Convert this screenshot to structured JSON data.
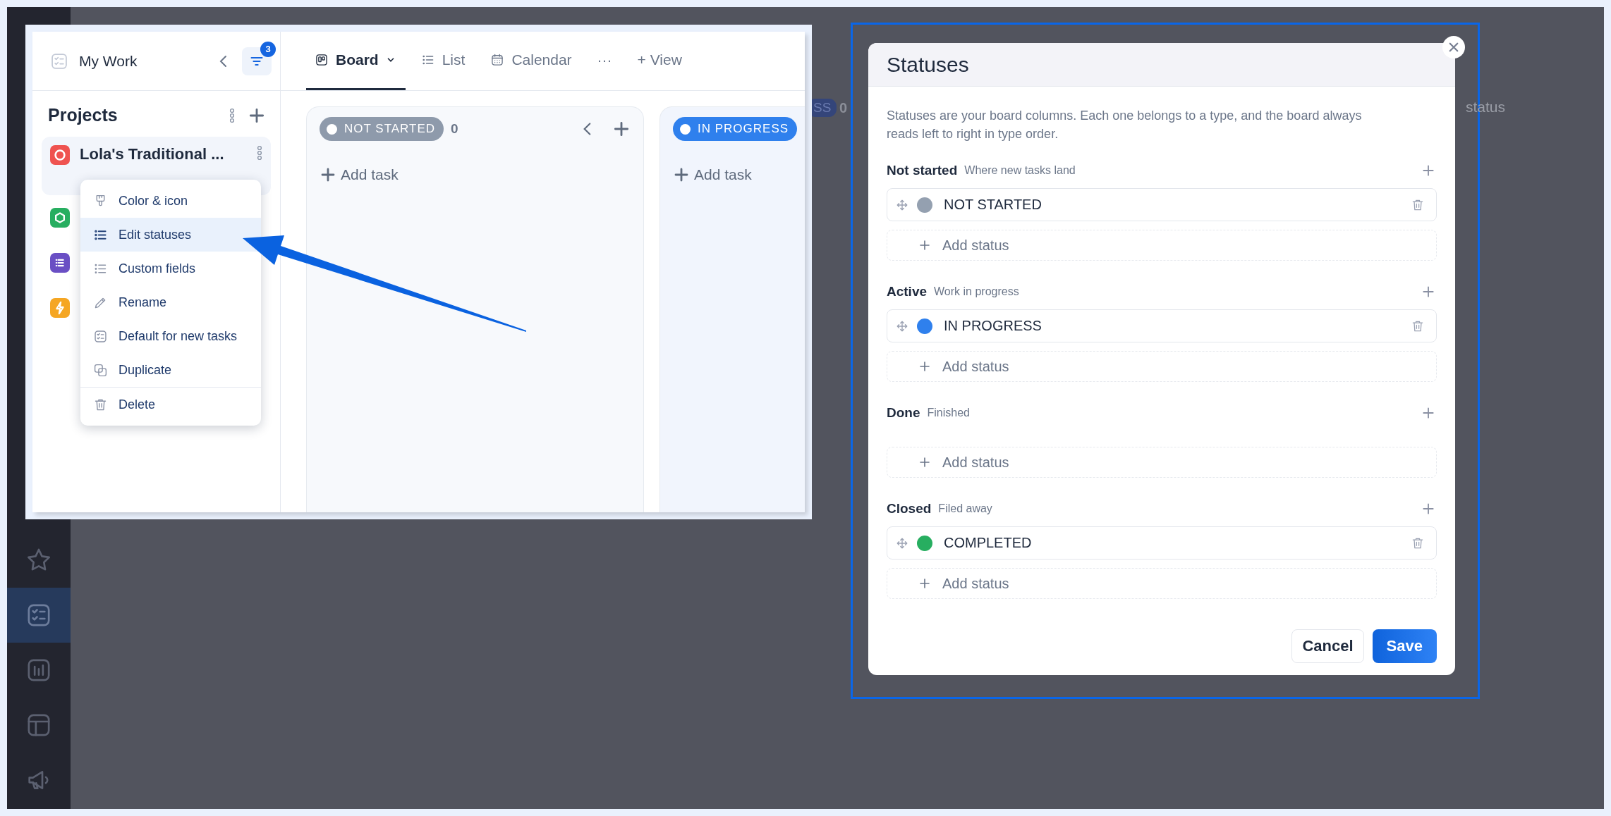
{
  "app_sidebar": {
    "items": [
      {
        "kind": "star",
        "selected": false
      },
      {
        "kind": "checklist",
        "selected": true
      },
      {
        "kind": "chart",
        "selected": false
      },
      {
        "kind": "layout",
        "selected": false
      },
      {
        "kind": "megaphone",
        "selected": false
      }
    ]
  },
  "background": {
    "badge": "SS",
    "count": "0",
    "text": "status"
  },
  "inset": {
    "sidebar": {
      "title": "My Work",
      "filter_count": "3",
      "section": "Projects",
      "projects": [
        {
          "name": "Lola's Traditional ...",
          "color": "#ef5350",
          "kind": "circle",
          "selected": true
        },
        {
          "color": "#27ae60",
          "kind": "hexagon",
          "selected": false
        },
        {
          "color": "#6a4fc4",
          "kind": "list",
          "selected": false
        },
        {
          "color": "#f5a623",
          "kind": "bolt",
          "selected": false
        }
      ]
    },
    "menu": [
      {
        "label": "Color & icon",
        "kind": "brush",
        "selected": false,
        "divider_above": false
      },
      {
        "label": "Edit statuses",
        "kind": "list",
        "selected": true,
        "divider_above": false
      },
      {
        "label": "Custom fields",
        "kind": "list",
        "selected": false,
        "divider_above": false
      },
      {
        "label": "Rename",
        "kind": "pencil",
        "selected": false,
        "divider_above": false
      },
      {
        "label": "Default for new tasks",
        "kind": "checklist",
        "selected": false,
        "divider_above": false
      },
      {
        "label": "Duplicate",
        "kind": "duplicate",
        "selected": false,
        "divider_above": false
      },
      {
        "label": "Delete",
        "kind": "trash",
        "selected": false,
        "divider_above": true
      }
    ],
    "tabs": [
      {
        "label": "Board",
        "kind": "board",
        "selected": true
      },
      {
        "label": "List",
        "kind": "list",
        "selected": false
      },
      {
        "label": "Calendar",
        "kind": "calendar",
        "selected": false
      },
      {
        "label": "···",
        "kind": "more",
        "selected": false
      },
      {
        "label": "+ View",
        "kind": "add",
        "selected": false
      }
    ],
    "columns": [
      {
        "status": "NOT STARTED",
        "color": "#8e9aab",
        "count": "0",
        "add_label": "Add task"
      },
      {
        "status": "IN PROGRESS",
        "color": "#2f80ed",
        "add_label": "Add task"
      }
    ]
  },
  "dialog": {
    "title": "Statuses",
    "description": "Statuses are your board columns. Each one belongs to a type, and the board always reads left to right in type order.",
    "groups": [
      {
        "name": "Not started",
        "hint": "Where new tasks land",
        "statuses": [
          {
            "name": "NOT STARTED",
            "color": "#94a0b0"
          }
        ],
        "add_label": "Add status"
      },
      {
        "name": "Active",
        "hint": "Work in progress",
        "statuses": [
          {
            "name": "IN PROGRESS",
            "color": "#2f80ed"
          }
        ],
        "add_label": "Add status"
      },
      {
        "name": "Done",
        "hint": "Finished",
        "add_label": "Add status"
      },
      {
        "name": "Closed",
        "hint": "Filed away",
        "statuses": [
          {
            "name": "COMPLETED",
            "color": "#27ae60"
          }
        ],
        "add_label": "Add status"
      }
    ],
    "buttons": [
      {
        "label": "Cancel",
        "kind": "secondary"
      },
      {
        "label": "Save",
        "kind": "primary"
      }
    ]
  }
}
